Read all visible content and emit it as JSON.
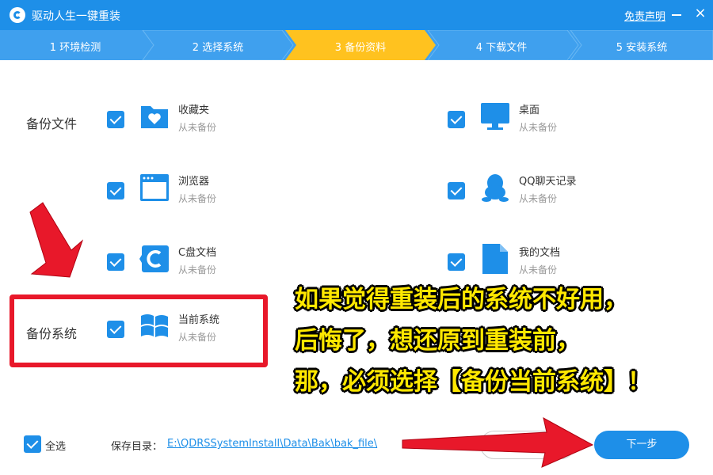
{
  "window": {
    "title": "驱动人生一键重装",
    "disclaimer": "免责声明",
    "close_glyph": "×"
  },
  "steps": [
    {
      "label": "1 环境检测",
      "active": false
    },
    {
      "label": "2 选择系统",
      "active": false
    },
    {
      "label": "3 备份资料",
      "active": true
    },
    {
      "label": "4 下载文件",
      "active": false
    },
    {
      "label": "5 安装系统",
      "active": false
    }
  ],
  "backup_files": {
    "section_label": "备份文件",
    "items": [
      {
        "name": "收藏夹",
        "status": "从未备份",
        "icon": "heart-folder-icon",
        "checked": true
      },
      {
        "name": "桌面",
        "status": "从未备份",
        "icon": "desktop-monitor-icon",
        "checked": true
      },
      {
        "name": "浏览器",
        "status": "从未备份",
        "icon": "browser-window-icon",
        "checked": true
      },
      {
        "name": "QQ聊天记录",
        "status": "从未备份",
        "icon": "qq-penguin-icon",
        "checked": true
      },
      {
        "name": "C盘文档",
        "status": "从未备份",
        "icon": "c-drive-icon",
        "checked": true
      },
      {
        "name": "我的文档",
        "status": "从未备份",
        "icon": "document-icon",
        "checked": true
      }
    ]
  },
  "backup_system": {
    "section_label": "备份系统",
    "item": {
      "name": "当前系统",
      "status": "从未备份",
      "icon": "windows-logo-icon",
      "checked": true
    }
  },
  "overlay": {
    "lines": [
      "如果觉得重装后的系统不好用，",
      "后悔了，想还原到重装前，",
      "那，必须选择【备份当前系统】！"
    ],
    "color": "#ffe800"
  },
  "footer": {
    "select_all_label": "全选",
    "select_all_checked": true,
    "save_dir_label": "保存目录：",
    "save_dir_path": "E:\\QDRSSystemInstall\\Data\\Bak\\bak_file\\",
    "next_label": "下一步"
  },
  "colors": {
    "primary": "#1e8fe8",
    "step_bar": "#3fa0ee",
    "active_step": "#ffc21f",
    "highlight": "#e8182a"
  }
}
